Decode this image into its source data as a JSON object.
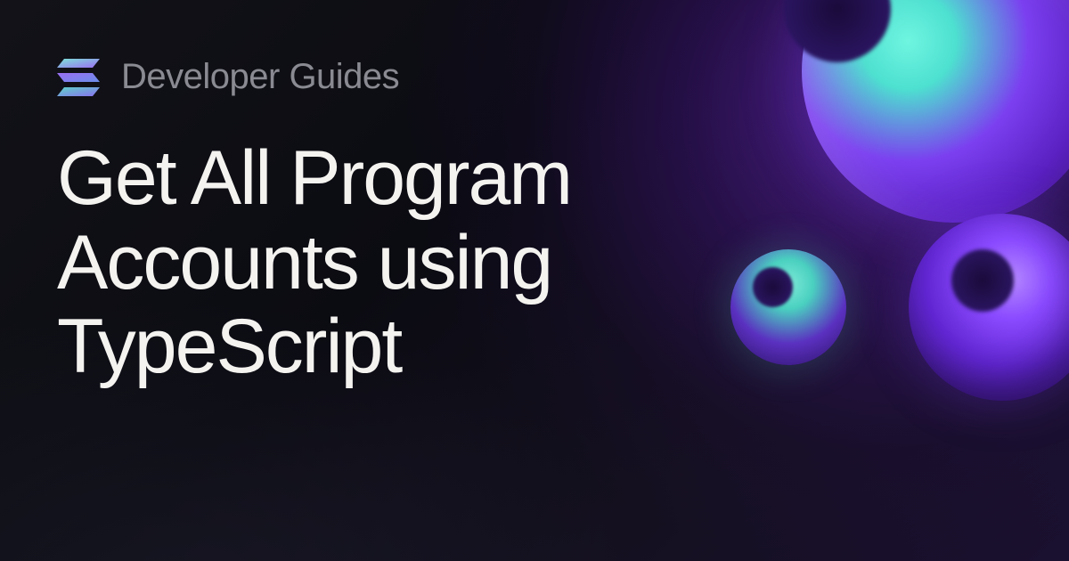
{
  "header": {
    "subtitle": "Developer Guides"
  },
  "main": {
    "title": "Get All Program Accounts using TypeScript"
  },
  "brand": {
    "logo_gradient_top": "#7de3d8",
    "logo_gradient_mid": "#9b6ef3",
    "logo_gradient_bottom": "#5ed3c8"
  }
}
